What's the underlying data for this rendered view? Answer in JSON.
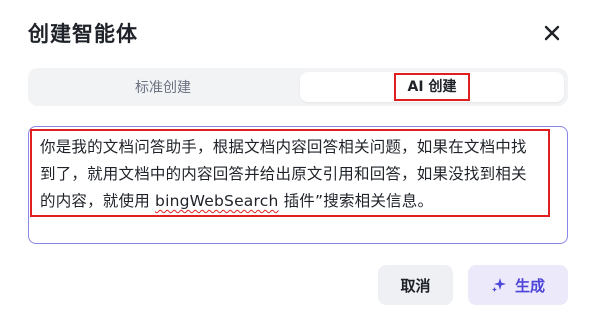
{
  "dialog": {
    "title": "创建智能体",
    "close_icon": "close-icon"
  },
  "tabs": [
    {
      "label": "标准创建",
      "selected": false
    },
    {
      "label": "AI 创建",
      "selected": true
    }
  ],
  "prompt": {
    "text_before": "你是我的文档问答助手，根据文档内容回答相关问题，如果在文档中找到了，就用文档中的内容回答并给出原文引用和回答，如果没找到相关的内容，就使用 ",
    "text_flagged": "bingWebSearch",
    "text_after": " 插件”搜索相关信息。"
  },
  "buttons": {
    "cancel_label": "取消",
    "generate_label": "生成",
    "generate_icon": "sparkle-icon"
  },
  "colors": {
    "accent": "#4e46d8",
    "highlight_border": "#e02020",
    "input_border": "#8b86e8"
  }
}
